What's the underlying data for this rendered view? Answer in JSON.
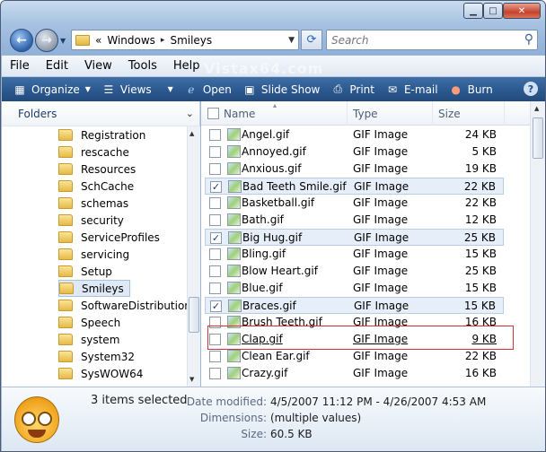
{
  "nav": {
    "address": {
      "crumbs": [
        "Windows",
        "Smileys"
      ],
      "overflow": "«"
    },
    "search": {
      "placeholder": "Search"
    }
  },
  "menu": [
    "File",
    "Edit",
    "View",
    "Tools",
    "Help"
  ],
  "watermark": "Vistax64.com",
  "toolbar": {
    "organize": "Organize",
    "views": "Views",
    "open": "Open",
    "slideshow": "Slide Show",
    "print": "Print",
    "email": "E-mail",
    "burn": "Burn",
    "help": "?"
  },
  "navpane": {
    "header": "Folders",
    "items": [
      "Registration",
      "rescache",
      "Resources",
      "SchCache",
      "schemas",
      "security",
      "ServiceProfiles",
      "servicing",
      "Setup",
      "Smileys",
      "SoftwareDistribution",
      "Speech",
      "system",
      "System32",
      "SysWOW64"
    ],
    "selected": "Smileys"
  },
  "columns": {
    "name": "Name",
    "type": "Type",
    "size": "Size"
  },
  "files": [
    {
      "name": "Angel.gif",
      "type": "GIF Image",
      "size": "24 KB",
      "checked": false,
      "selected": false
    },
    {
      "name": "Annoyed.gif",
      "type": "GIF Image",
      "size": "5 KB",
      "checked": false,
      "selected": false
    },
    {
      "name": "Anxious.gif",
      "type": "GIF Image",
      "size": "19 KB",
      "checked": false,
      "selected": false
    },
    {
      "name": "Bad Teeth Smile.gif",
      "type": "GIF Image",
      "size": "22 KB",
      "checked": true,
      "selected": true
    },
    {
      "name": "Basketball.gif",
      "type": "GIF Image",
      "size": "22 KB",
      "checked": false,
      "selected": false
    },
    {
      "name": "Bath.gif",
      "type": "GIF Image",
      "size": "12 KB",
      "checked": false,
      "selected": false
    },
    {
      "name": "Big Hug.gif",
      "type": "GIF Image",
      "size": "25 KB",
      "checked": true,
      "selected": true
    },
    {
      "name": "Bling.gif",
      "type": "GIF Image",
      "size": "15 KB",
      "checked": false,
      "selected": false
    },
    {
      "name": "Blow Heart.gif",
      "type": "GIF Image",
      "size": "25 KB",
      "checked": false,
      "selected": false
    },
    {
      "name": "Blue.gif",
      "type": "GIF Image",
      "size": "15 KB",
      "checked": false,
      "selected": false
    },
    {
      "name": "Braces.gif",
      "type": "GIF Image",
      "size": "15 KB",
      "checked": true,
      "selected": true
    },
    {
      "name": "Brush Teeth.gif",
      "type": "GIF Image",
      "size": "16 KB",
      "checked": false,
      "selected": false
    },
    {
      "name": "Clap.gif",
      "type": "GIF Image",
      "size": "9 KB",
      "checked": false,
      "selected": false,
      "hover": true
    },
    {
      "name": "Clean Ear.gif",
      "type": "GIF Image",
      "size": "22 KB",
      "checked": false,
      "selected": false
    },
    {
      "name": "Crazy.gif",
      "type": "GIF Image",
      "size": "16 KB",
      "checked": false,
      "selected": false
    }
  ],
  "details": {
    "selection": "3 items selected",
    "modified_label": "Date modified:",
    "modified_value": "4/5/2007 11:12 PM - 4/26/2007 4:53 AM",
    "dimensions_label": "Dimensions:",
    "dimensions_value": "(multiple values)",
    "size_label": "Size:",
    "size_value": "60.5 KB"
  },
  "colors": {
    "toolbar": "#2d5a91",
    "selection": "#e6eff9",
    "highlight_box": "#d4313a"
  }
}
